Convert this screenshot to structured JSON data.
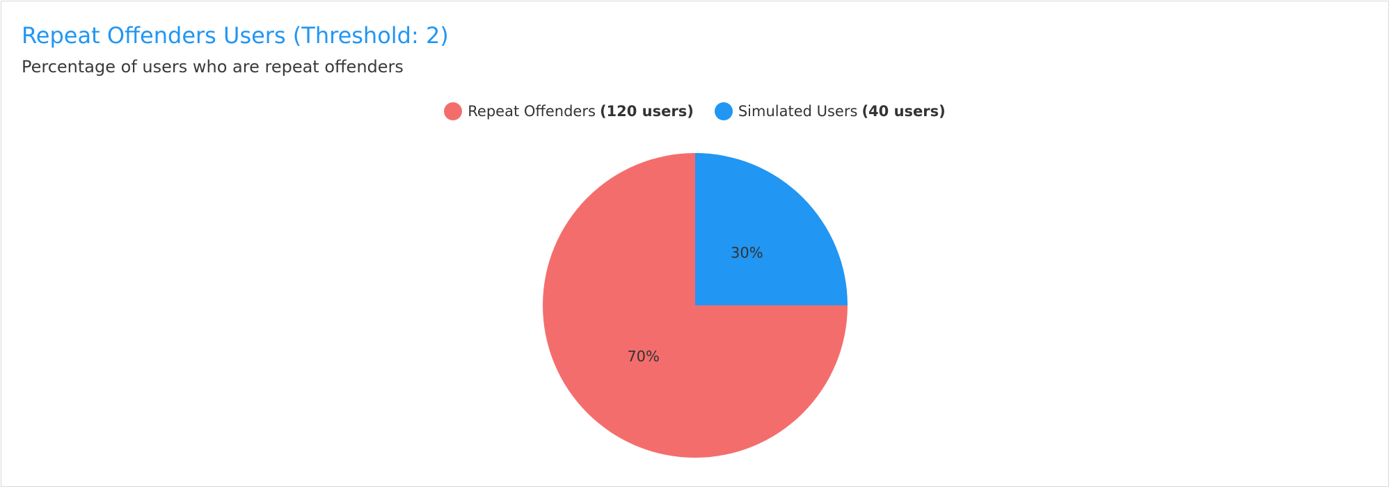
{
  "header": {
    "title": "Repeat Offenders Users (Threshold: 2)",
    "subtitle": "Percentage of users who are repeat offenders"
  },
  "legend": {
    "items": [
      {
        "label": "Repeat Offenders",
        "count": "(120 users)",
        "color": "#f46d6d"
      },
      {
        "label": "Simulated Users",
        "count": "(40 users)",
        "color": "#2196f3"
      }
    ]
  },
  "chart_data": {
    "type": "pie",
    "title": "Repeat Offenders Users (Threshold: 2)",
    "subtitle": "Percentage of users who are repeat offenders",
    "slices": [
      {
        "name": "Repeat Offenders",
        "value": 120,
        "label": "70%",
        "color": "#f46d6d"
      },
      {
        "name": "Simulated Users",
        "value": 40,
        "label": "30%",
        "color": "#2196f3"
      }
    ],
    "legend_position": "top-center"
  }
}
